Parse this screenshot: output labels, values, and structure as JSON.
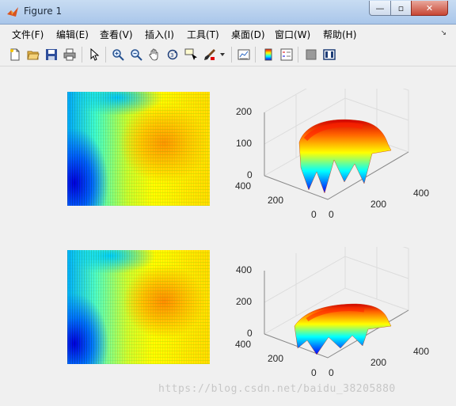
{
  "window": {
    "title": "Figure 1",
    "min": "—",
    "max": "▫",
    "close": "✕"
  },
  "menu": [
    "文件(F)",
    "编辑(E)",
    "查看(V)",
    "插入(I)",
    "工具(T)",
    "桌面(D)",
    "窗口(W)",
    "帮助(H)"
  ],
  "toolbar": [
    "new-figure",
    "open-file",
    "save",
    "print",
    "pointer",
    "zoom-in",
    "zoom-out",
    "pan",
    "rotate-3d",
    "data-cursor",
    "brush",
    "brush-dropdown",
    "link-plot",
    "colorbar",
    "legend",
    "hide-plot-tools",
    "show-plot-tools"
  ],
  "plots": [
    {
      "z_ticks": [
        "200",
        "100",
        "0"
      ],
      "y_ticks": [
        "400",
        "200",
        "0"
      ],
      "x_ticks": [
        "0",
        "200",
        "400"
      ]
    },
    {
      "z_ticks": [
        "400",
        "200",
        "0"
      ],
      "y_ticks": [
        "400",
        "200",
        "0"
      ],
      "x_ticks": [
        "0",
        "200",
        "400"
      ]
    }
  ],
  "watermark": "https://blog.csdn.net/baidu_38205880",
  "colors": {
    "jet_blue": "#0000ff",
    "jet_cyan": "#00ffff",
    "jet_yellow": "#ffff00",
    "jet_red": "#ff0000"
  }
}
